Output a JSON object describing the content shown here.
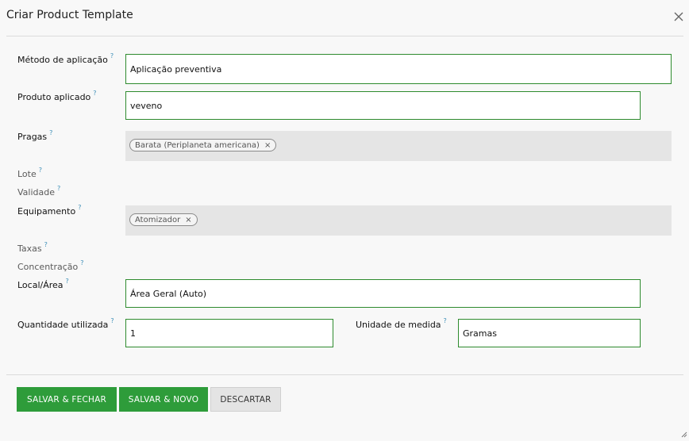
{
  "dialog": {
    "title": "Criar Product Template"
  },
  "help_mark": "?",
  "form": {
    "metodo": {
      "label": "Método de aplicação",
      "value": "Aplicação preventiva"
    },
    "produto": {
      "label": "Produto aplicado",
      "value": "veveno"
    },
    "pragas": {
      "label": "Pragas",
      "tags": [
        {
          "text": "Barata (Periplaneta americana)",
          "remove": "×"
        }
      ]
    },
    "lote": {
      "label": "Lote"
    },
    "validade": {
      "label": "Validade"
    },
    "equipamento": {
      "label": "Equipamento",
      "tags": [
        {
          "text": "Atomizador",
          "remove": "×"
        }
      ]
    },
    "taxas": {
      "label": "Taxas"
    },
    "concentracao": {
      "label": "Concentração"
    },
    "local": {
      "label": "Local/Área",
      "value": "Área Geral (Auto)"
    },
    "quantidade": {
      "label": "Quantidade utilizada",
      "value": "1"
    },
    "unidade": {
      "label": "Unidade de medida",
      "value": "Gramas"
    }
  },
  "footer": {
    "save_close": "SALVAR & FECHAR",
    "save_new": "SALVAR & NOVO",
    "discard": "DESCARTAR"
  },
  "colors": {
    "primary": "#2e9c3a",
    "field_border": "#2e8b2e",
    "help_icon": "#3d8fb8",
    "tag_area": "#e5e5e5"
  }
}
